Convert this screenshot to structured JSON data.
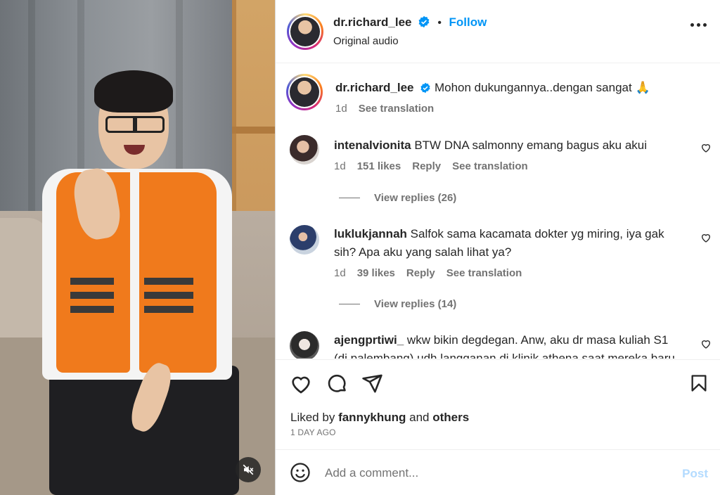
{
  "post": {
    "author": "dr.richard_lee",
    "follow_label": "Follow",
    "dot": "•",
    "audio": "Original audio"
  },
  "caption": {
    "author": "dr.richard_lee",
    "text": "Mohon dukungannya..dengan sangat 🙏",
    "time": "1d",
    "see_translation": "See translation"
  },
  "comments": [
    {
      "username": "intenalvionita",
      "text": "BTW DNA salmonny emang bagus aku akui",
      "time": "1d",
      "likes": "151 likes",
      "reply": "Reply",
      "see_translation": "See translation",
      "view_replies": "View replies (26)"
    },
    {
      "username": "luklukjannah",
      "text": "Salfok sama kacamata dokter yg miring, iya gak sih? Apa aku yang salah lihat ya?",
      "time": "1d",
      "likes": "39 likes",
      "reply": "Reply",
      "see_translation": "See translation",
      "view_replies": "View replies (14)"
    },
    {
      "username": "ajengprtiwi_",
      "text": "wkw bikin degdegan. Anw, aku dr masa kuliah S1 (di palembang) udh langganan di klinik athena saat mereka baru"
    }
  ],
  "likes_line": {
    "prefix": "Liked by",
    "user": "fannykhung",
    "and": "and",
    "others": "others"
  },
  "timestamp": "1 DAY AGO",
  "composer": {
    "placeholder": "Add a comment...",
    "post_label": "Post"
  },
  "colors": {
    "accent": "#0095f6",
    "post_disabled": "#b3dbff",
    "vest": "#f07a1c"
  }
}
